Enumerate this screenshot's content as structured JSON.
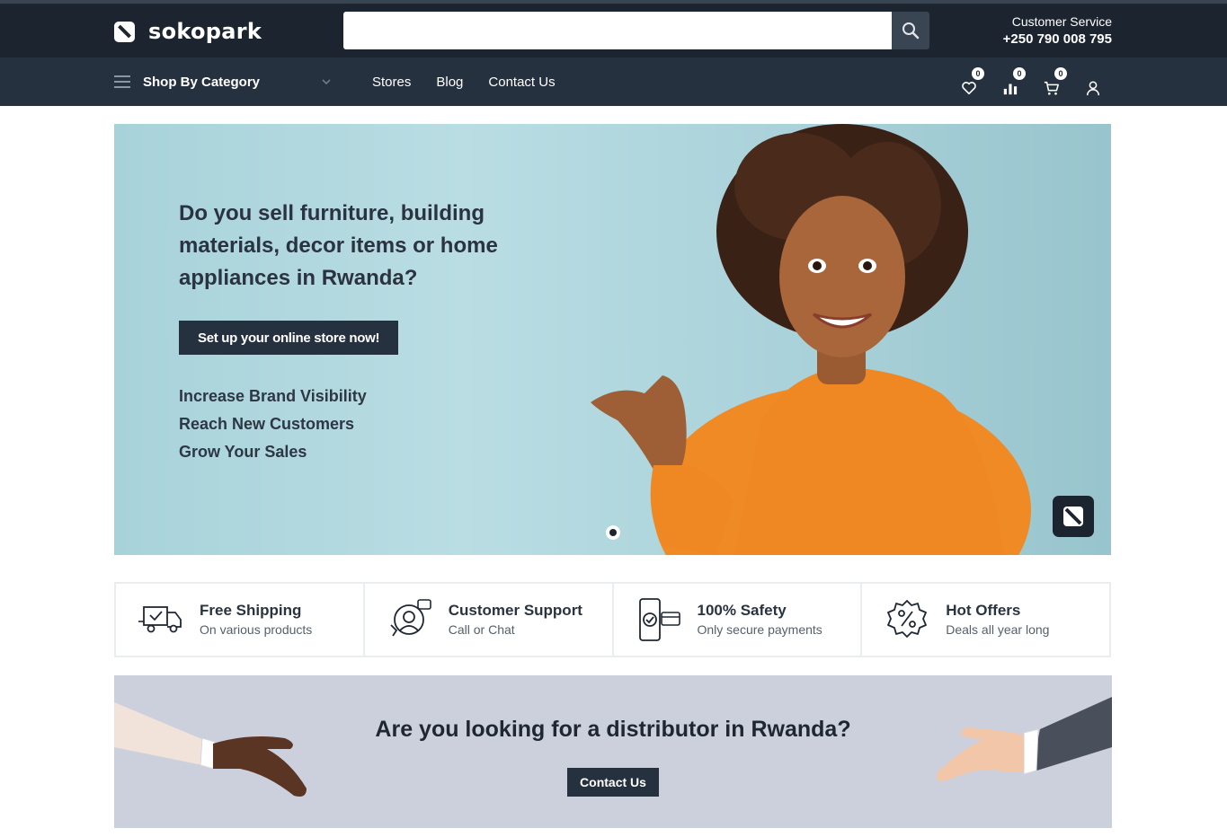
{
  "header": {
    "logo_text": "sokopark",
    "search": {
      "placeholder": ""
    },
    "customer_service": {
      "label": "Customer Service",
      "phone": "+250 790 008 795"
    }
  },
  "nav": {
    "category_label": "Shop By Category",
    "links": [
      "Stores",
      "Blog",
      "Contact Us"
    ],
    "wishlist_count": "0",
    "compare_count": "0",
    "cart_count": "0"
  },
  "hero": {
    "title": "Do you sell furniture, building materials, decor items or home appliances in Rwanda?",
    "cta": "Set up your online store now!",
    "benefits": [
      "Increase Brand Visibility",
      "Reach New Customers",
      "Grow Your Sales"
    ]
  },
  "features": [
    {
      "icon": "truck-icon",
      "title": "Free Shipping",
      "subtitle": "On various products"
    },
    {
      "icon": "support-agent-icon",
      "title": "Customer Support",
      "subtitle": "Call or Chat"
    },
    {
      "icon": "secure-payment-icon",
      "title": "100% Safety",
      "subtitle": "Only secure payments"
    },
    {
      "icon": "discount-icon",
      "title": "Hot Offers",
      "subtitle": "Deals all year long"
    }
  ],
  "distributor": {
    "title": "Are you looking for a distributor in Rwanda?",
    "cta": "Contact Us"
  },
  "colors": {
    "header_bg": "#1c2430",
    "nav_bg": "#263140",
    "button_bg": "#263140",
    "hero_bg": "#b9dde3",
    "sweater": "#f08a24"
  }
}
